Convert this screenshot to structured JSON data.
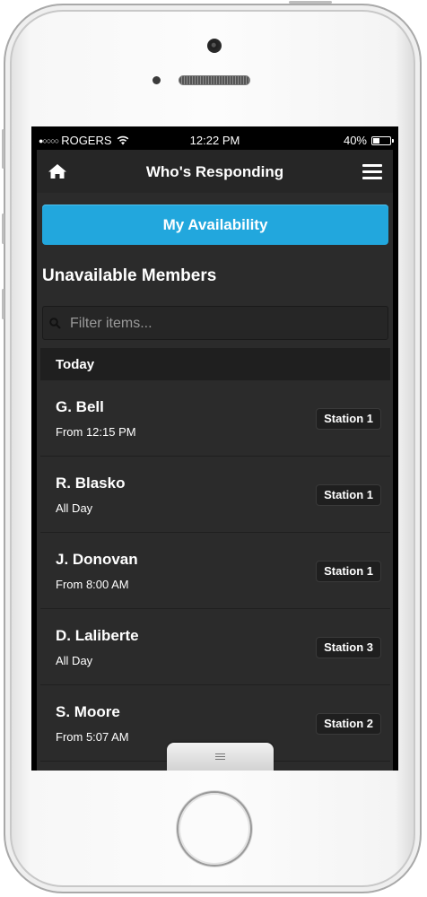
{
  "status_bar": {
    "signal": "●○○○○",
    "carrier": "ROGERS",
    "time": "12:22 PM",
    "battery": "40%",
    "battery_level": 0.4
  },
  "header": {
    "title": "Who's Responding",
    "left_icon": "home-icon",
    "right_icon": "menu-icon"
  },
  "availability_button": "My Availability",
  "section_title": "Unavailable Members",
  "filter": {
    "placeholder": "Filter items...",
    "icon": "search-icon"
  },
  "group_label": "Today",
  "members": [
    {
      "name": "G. Bell",
      "time": "From 12:15 PM",
      "station": "Station 1"
    },
    {
      "name": "R. Blasko",
      "time": "All Day",
      "station": "Station 1"
    },
    {
      "name": "J. Donovan",
      "time": "From 8:00 AM",
      "station": "Station 1"
    },
    {
      "name": "D. Laliberte",
      "time": "All Day",
      "station": "Station 3"
    },
    {
      "name": "S. Moore",
      "time": "From 5:07 AM",
      "station": "Station 2"
    }
  ],
  "colors": {
    "accent": "#22a7dd",
    "background": "#2b2b2b",
    "header": "#262626"
  }
}
